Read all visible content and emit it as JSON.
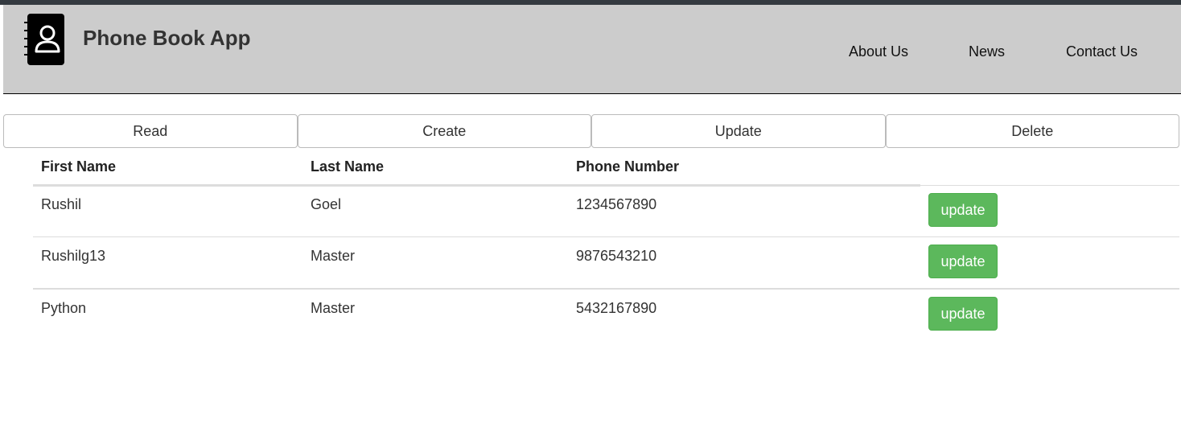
{
  "header": {
    "title": "Phone Book App",
    "logo_icon": "phonebook-contact-icon",
    "nav": [
      "About Us",
      "News",
      "Contact Us"
    ]
  },
  "operations": [
    "Read",
    "Create",
    "Update",
    "Delete"
  ],
  "table": {
    "columns": [
      "First Name",
      "Last Name",
      "Phone Number"
    ],
    "rows": [
      {
        "first": "Rushil",
        "last": "Goel",
        "phone": "1234567890",
        "action": "update"
      },
      {
        "first": "Rushilg13",
        "last": "Master",
        "phone": "9876543210",
        "action": "update"
      },
      {
        "first": "Python",
        "last": "Master",
        "phone": "5432167890",
        "action": "update"
      }
    ]
  },
  "colors": {
    "header_bg": "#cccccc",
    "topbar": "#343a40",
    "update_button": "#5cb85c"
  }
}
